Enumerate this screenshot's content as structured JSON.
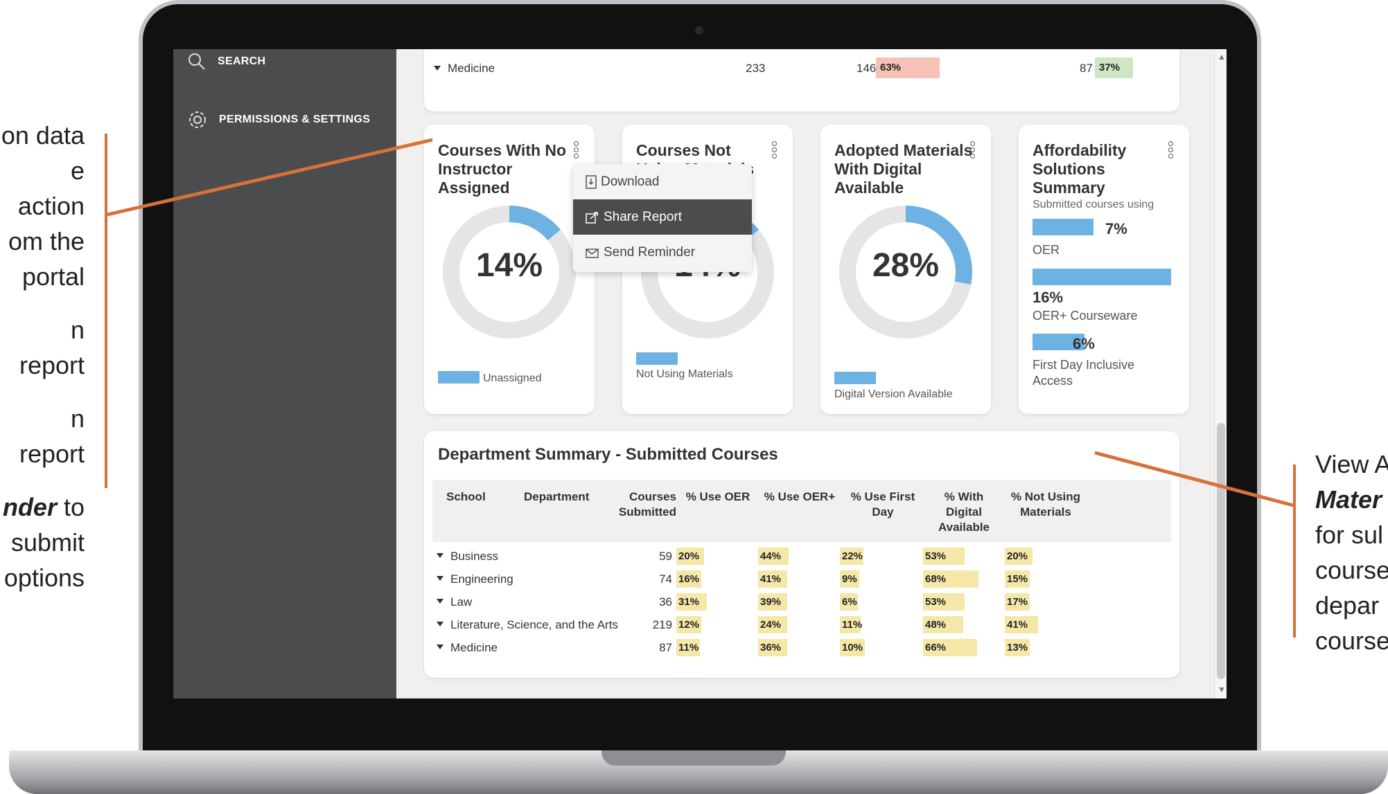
{
  "callouts": {
    "left": [
      "on data",
      "e action",
      "om the",
      "portal",
      "",
      "n report",
      "",
      "n report",
      "",
      "nder to",
      "submit",
      "options"
    ],
    "left_italic_word": "nder",
    "right": [
      "View A",
      "Mater",
      "for sul",
      "course",
      "depar",
      "course"
    ]
  },
  "sidebar": {
    "search_label": "SEARCH",
    "permissions_label": "PERMISSIONS & SETTINGS"
  },
  "top_row": {
    "name": "Medicine",
    "total": "233",
    "not_count": "146",
    "not_pct": "63%",
    "count": "87",
    "pct": "37%"
  },
  "cards": [
    {
      "title": "Courses With No Instructor Assigned",
      "percent": 14,
      "percent_label": "14%",
      "legend": "Unassigned"
    },
    {
      "title": "Courses Not Using Materials",
      "percent": 14,
      "percent_label": "14%",
      "legend": "Not Using Materials"
    },
    {
      "title": "Adopted Materials With Digital Available",
      "percent": 28,
      "percent_label": "28%",
      "legend": "Digital Version Available"
    }
  ],
  "menu": {
    "download": "Download",
    "share": "Share Report",
    "reminder": "Send Reminder"
  },
  "affordability": {
    "title": "Affordability Solutions Summary",
    "subtitle": "Submitted courses using",
    "items": [
      {
        "pct": "7%",
        "value": 7,
        "label": "OER"
      },
      {
        "pct": "16%",
        "value": 16,
        "label": "OER+ Courseware"
      },
      {
        "pct": "6%",
        "value": 6,
        "label": "First Day Inclusive Access"
      }
    ]
  },
  "dept": {
    "title": "Department Summary - Submitted Courses",
    "headers": [
      "School",
      "Department",
      "Courses Submitted",
      "% Use OER",
      "% Use OER+",
      "% Use First Day",
      "% With Digital Available",
      "% Not Using Materials"
    ],
    "rows": [
      {
        "school": "Business",
        "courses": "59",
        "oer": "20%",
        "oerplus": "44%",
        "firstday": "22%",
        "digital": "53%",
        "notusing": "20%"
      },
      {
        "school": "Engineering",
        "courses": "74",
        "oer": "16%",
        "oerplus": "41%",
        "firstday": "9%",
        "digital": "68%",
        "notusing": "15%"
      },
      {
        "school": "Law",
        "courses": "36",
        "oer": "31%",
        "oerplus": "39%",
        "firstday": "6%",
        "digital": "53%",
        "notusing": "17%"
      },
      {
        "school": "Literature, Science, and the Arts",
        "courses": "219",
        "oer": "12%",
        "oerplus": "24%",
        "firstday": "11%",
        "digital": "48%",
        "notusing": "41%"
      },
      {
        "school": "Medicine",
        "courses": "87",
        "oer": "11%",
        "oerplus": "36%",
        "firstday": "10%",
        "digital": "66%",
        "notusing": "13%"
      }
    ]
  },
  "colors": {
    "accent": "#6db2e2",
    "callout": "#d9703a",
    "sidebar": "#4a4c4e",
    "highlight": "#f5e7a8"
  }
}
